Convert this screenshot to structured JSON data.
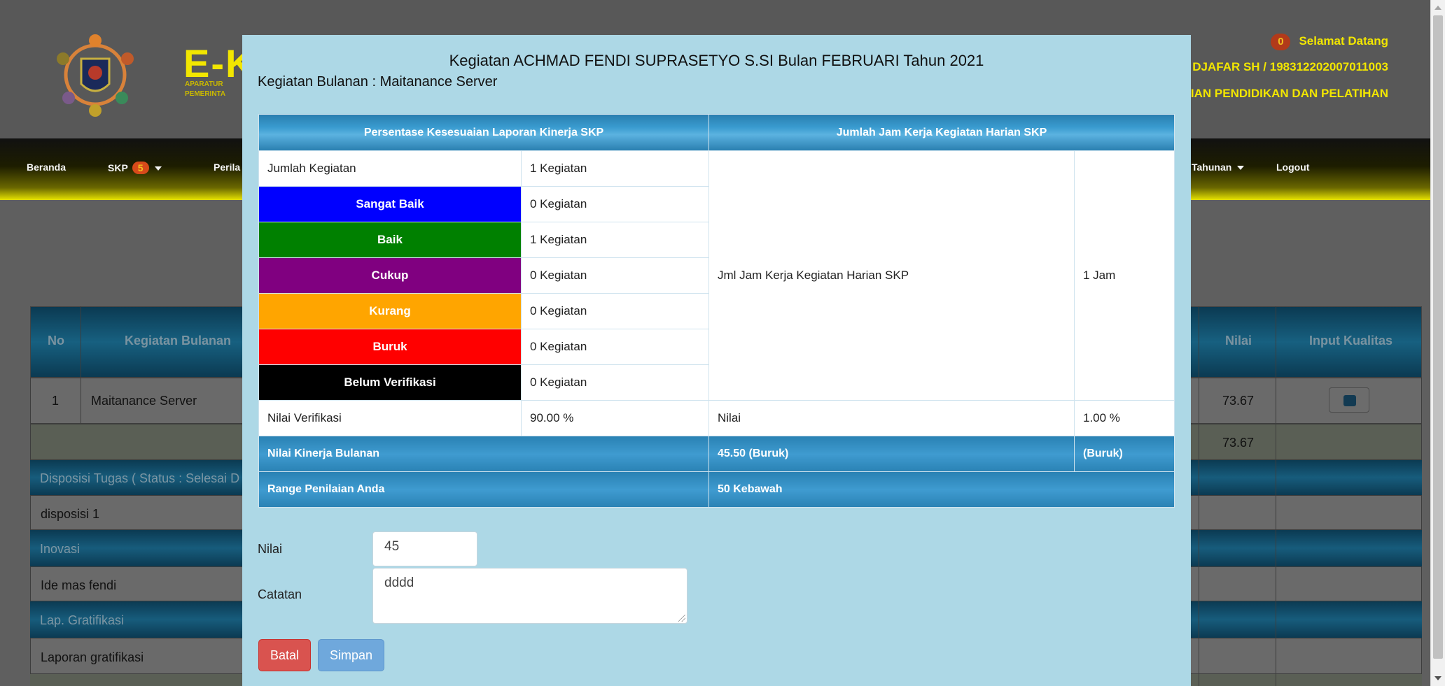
{
  "app": {
    "brand": "E-K",
    "brand_sub_line1": "APARATUR",
    "brand_sub_line2": "PEMERINTA",
    "notification_count": "0",
    "welcome": "Selamat Datang",
    "user_line": "DJAFAR SH / 198312202007011003",
    "unit_line": "AIAN PENDIDIKAN DAN PELATIHAN"
  },
  "nav": {
    "beranda": "Beranda",
    "skp": "SKP",
    "skp_badge": "5",
    "perila": "Perila",
    "tahunan": "Tahunan",
    "logout": "Logout"
  },
  "bg_table": {
    "col_no": "No",
    "col_kegiatan": "Kegiatan Bulanan",
    "col_nilai": "Nilai",
    "col_input": "Input Kualitas",
    "row1_no": "1",
    "row1_kegiatan": "Maitanance Server",
    "row1_nilai": "73.67",
    "total_nilai": "73.67",
    "disposisi_header": "Disposisi Tugas ( Status : Selesai D",
    "disposisi_item": "disposisi 1",
    "inovasi_header": "Inovasi",
    "inovasi_item": "Ide mas fendi",
    "gratifikasi_header": "Lap. Gratifikasi",
    "gratifikasi_item": "Laporan gratifikasi"
  },
  "modal": {
    "title": "Kegiatan ACHMAD FENDI SUPRASETYO S.SI Bulan FEBRUARI Tahun 2021",
    "subtitle": "Kegiatan Bulanan : Maitanance Server",
    "head_left": "Persentase Kesesuaian Laporan Kinerja SKP",
    "head_right": "Jumlah Jam Kerja Kegiatan Harian SKP",
    "jumlah_label": "Jumlah Kegiatan",
    "jumlah_value": "1 Kegiatan",
    "categories": [
      {
        "label": "Sangat Baik",
        "value": "0 Kegiatan",
        "color": "#0000ff"
      },
      {
        "label": "Baik",
        "value": "1 Kegiatan",
        "color": "#008000"
      },
      {
        "label": "Cukup",
        "value": "0 Kegiatan",
        "color": "#800080"
      },
      {
        "label": "Kurang",
        "value": "0 Kegiatan",
        "color": "#ffa500"
      },
      {
        "label": "Buruk",
        "value": "0 Kegiatan",
        "color": "#ff0000"
      },
      {
        "label": "Belum Verifikasi",
        "value": "0 Kegiatan",
        "color": "#000000"
      }
    ],
    "jam_label": "Jml Jam Kerja Kegiatan Harian SKP",
    "jam_value": "1 Jam",
    "nilai_verifikasi_label": "Nilai Verifikasi",
    "nilai_verifikasi_value": "90.00 %",
    "nilai_label": "Nilai",
    "nilai_value": "1.00 %",
    "kinerja_label": "Nilai Kinerja Bulanan",
    "kinerja_value": "45.50 (Buruk)",
    "kinerja_grade": "(Buruk)",
    "range_label": "Range Penilaian Anda",
    "range_value": "50 Kebawah"
  },
  "form": {
    "nilai_label": "Nilai",
    "nilai_value": "45",
    "catatan_label": "Catatan",
    "catatan_value": "dddd",
    "batal": "Batal",
    "simpan": "Simpan"
  }
}
